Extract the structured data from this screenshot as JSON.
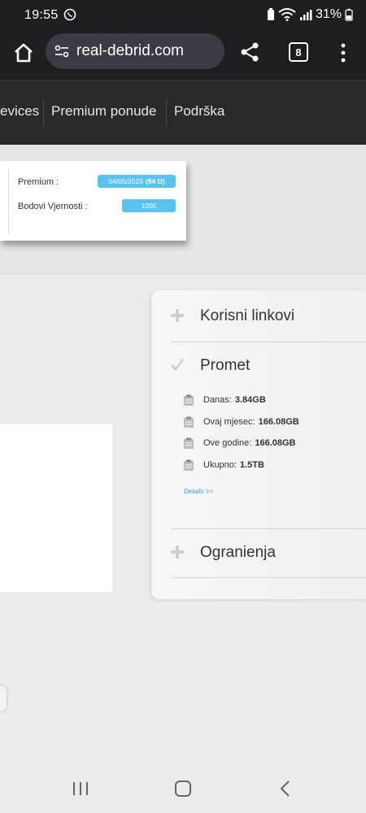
{
  "status_bar": {
    "time": "19:55",
    "battery": "31%"
  },
  "browser": {
    "url": "real-debrid.com",
    "tab_count": "8"
  },
  "site_nav": {
    "items": [
      "evices",
      "Premium ponude",
      "Podrška"
    ]
  },
  "account": {
    "premium_label": "Premium :",
    "premium_date": "04/05/2025",
    "premium_days": "(94 D)",
    "loyalty_label": "Bodovi Vjernosti :",
    "loyalty_value": "1000"
  },
  "sidebar": {
    "sections": [
      {
        "title": "Korisni linkovi",
        "icon": "plus-icon"
      },
      {
        "title": "Promet",
        "icon": "check-icon"
      },
      {
        "title": "Ogranienja",
        "icon": "plus-icon"
      }
    ],
    "traffic": [
      {
        "label": "Danas:",
        "value": "3.84GB"
      },
      {
        "label": "Ovaj mjesec:",
        "value": "166.08GB"
      },
      {
        "label": "Ove godine:",
        "value": "166.08GB"
      },
      {
        "label": "Ukupno:",
        "value": "1.5TB"
      }
    ],
    "details_link": "Details >>"
  },
  "colors": {
    "accent": "#58c3f0",
    "link": "#3aa0d8",
    "nav_bg": "#2a2a2a"
  }
}
